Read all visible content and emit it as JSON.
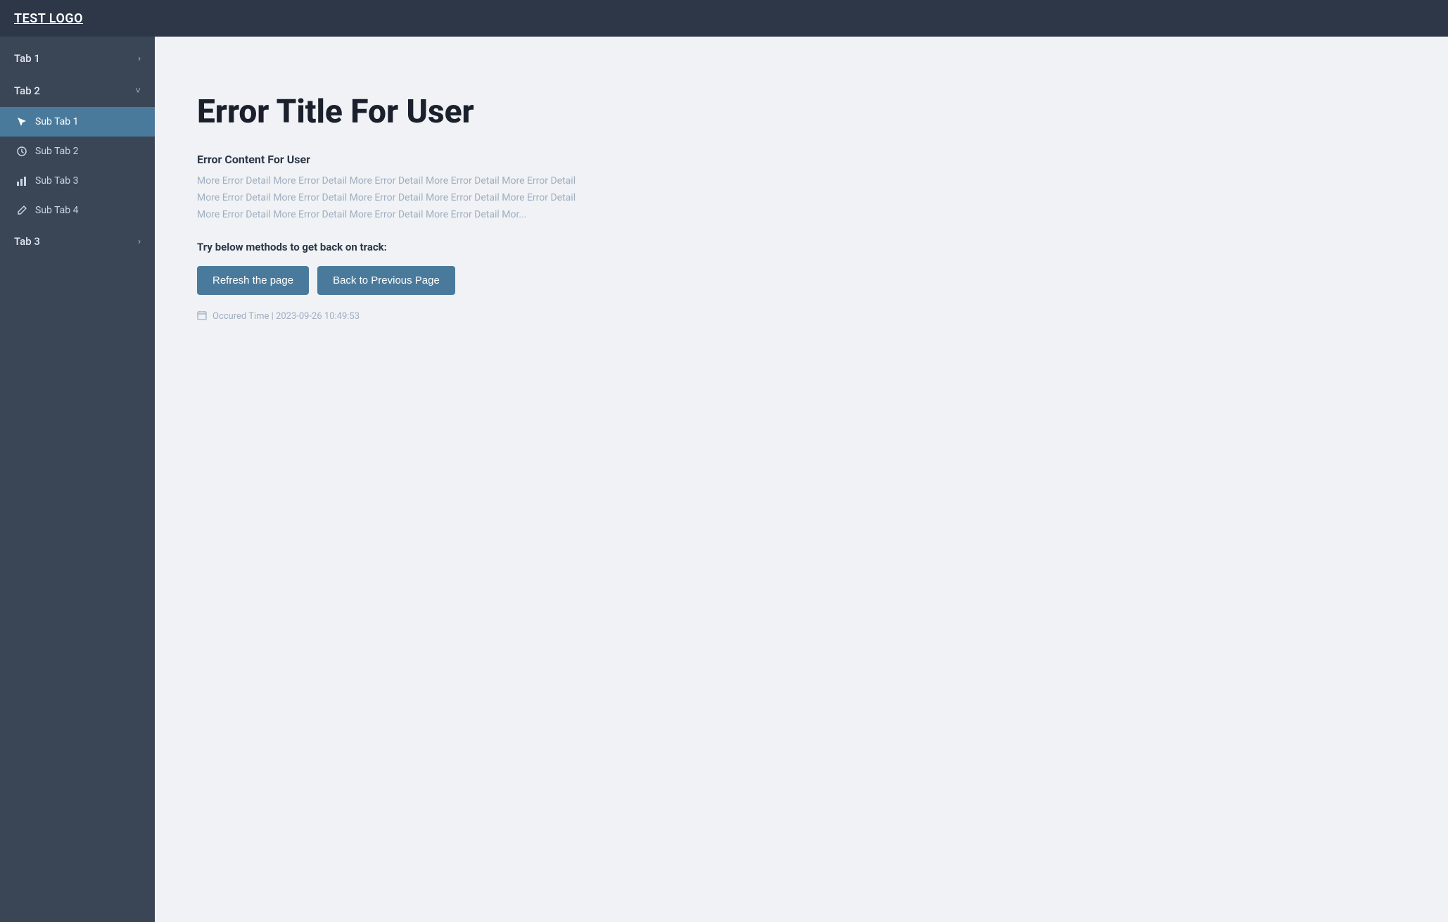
{
  "header": {
    "logo": "TEST LOGO"
  },
  "sidebar": {
    "items": [
      {
        "id": "tab1",
        "label": "Tab 1",
        "type": "parent",
        "expanded": false,
        "chevron": "›"
      },
      {
        "id": "tab2",
        "label": "Tab 2",
        "type": "parent",
        "expanded": true,
        "chevron": "˅"
      },
      {
        "id": "subtab1",
        "label": "Sub Tab 1",
        "type": "sub",
        "active": true,
        "icon": "cursor"
      },
      {
        "id": "subtab2",
        "label": "Sub Tab 2",
        "type": "sub",
        "active": false,
        "icon": "clock"
      },
      {
        "id": "subtab3",
        "label": "Sub Tab 3",
        "type": "sub",
        "active": false,
        "icon": "chart"
      },
      {
        "id": "subtab4",
        "label": "Sub Tab 4",
        "type": "sub",
        "active": false,
        "icon": "edit"
      },
      {
        "id": "tab3",
        "label": "Tab 3",
        "type": "parent",
        "expanded": false,
        "chevron": "›"
      }
    ]
  },
  "main": {
    "error_title": "Error Title For User",
    "error_content_label": "Error Content For User",
    "error_detail": "More Error Detail More Error Detail More Error Detail More Error Detail More Error Detail More Error Detail More Error Detail More Error Detail More Error Detail More Error Detail More Error Detail More Error Detail More Error Detail More Error Detail Mor...",
    "back_on_track": "Try below methods to get back on track:",
    "refresh_button": "Refresh the page",
    "back_button": "Back to Previous Page",
    "occurred_label": "Occured Time | 2023-09-26 10:49:53"
  },
  "colors": {
    "header_bg": "#2d3748",
    "sidebar_bg": "#3a4556",
    "active_item_bg": "#4a7a9b",
    "button_bg": "#4a7a9b",
    "main_bg": "#f0f2f5"
  }
}
